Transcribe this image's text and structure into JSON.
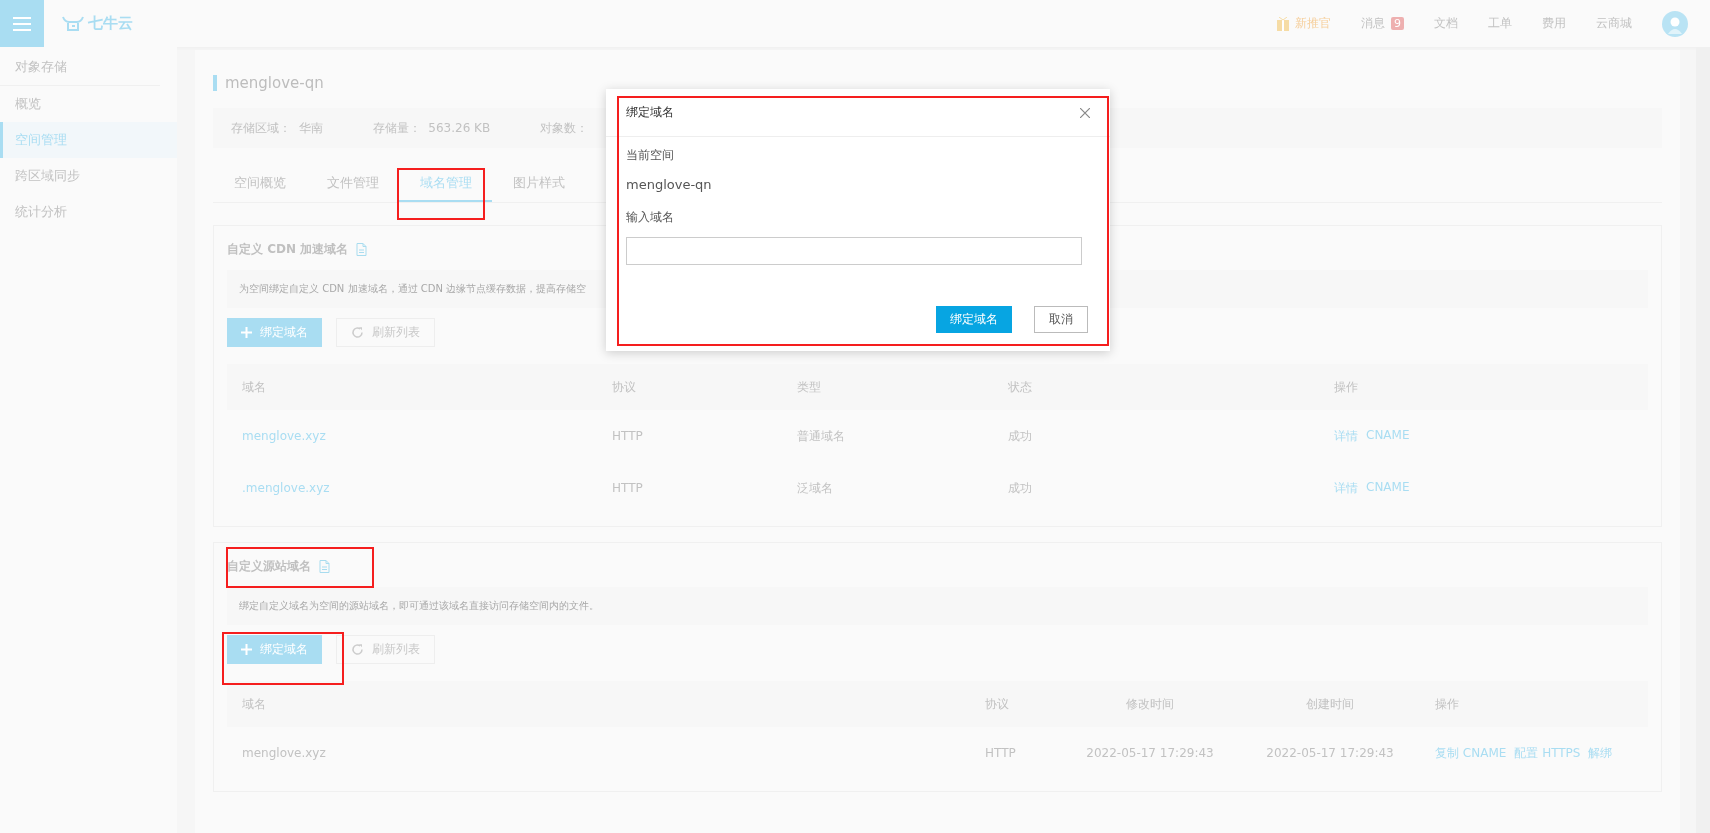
{
  "header": {
    "logo": "七牛云",
    "nav": [
      {
        "label": "新推官",
        "kind": "promo"
      },
      {
        "label": "消息",
        "kind": "badge",
        "badge": "9"
      },
      {
        "label": "文档",
        "kind": "plain"
      },
      {
        "label": "工单",
        "kind": "plain"
      },
      {
        "label": "费用",
        "kind": "plain"
      },
      {
        "label": "云商城",
        "kind": "plain"
      }
    ]
  },
  "sidebar": {
    "heading": "对象存储",
    "items": [
      {
        "label": "概览",
        "selected": false
      },
      {
        "label": "空间管理",
        "selected": true
      },
      {
        "label": "跨区域同步",
        "selected": false
      },
      {
        "label": "统计分析",
        "selected": false
      }
    ]
  },
  "bucket": {
    "title": "menglove-qn",
    "stats": [
      {
        "label": "存储区域：",
        "value": "华南"
      },
      {
        "label": "存储量：",
        "value": "563.26 KB"
      },
      {
        "label": "对象数："
      }
    ]
  },
  "tabs": [
    {
      "label": "空间概览",
      "selected": false
    },
    {
      "label": "文件管理",
      "selected": false
    },
    {
      "label": "域名管理",
      "selected": true
    },
    {
      "label": "图片样式",
      "selected": false
    }
  ],
  "cdn_section": {
    "title": "自定义 CDN 加速域名",
    "description": "为空间绑定自定义 CDN 加速域名，通过 CDN 边缘节点缓存数据，提高存储空",
    "bind_button": "绑定域名",
    "refresh_button": "刷新列表",
    "columns": [
      "域名",
      "协议",
      "类型",
      "状态",
      "操作"
    ],
    "rows": [
      {
        "domain": "menglove.xyz",
        "protocol": "HTTP",
        "type": "普通域名",
        "status": "成功",
        "actions": [
          "详情",
          "CNAME"
        ]
      },
      {
        "domain": ".menglove.xyz",
        "protocol": "HTTP",
        "type": "泛域名",
        "status": "成功",
        "actions": [
          "详情",
          "CNAME"
        ]
      }
    ]
  },
  "source_section": {
    "title": "自定义源站域名",
    "description": "绑定自定义域名为空间的源站域名，即可通过该域名直接访问存储空间内的文件。",
    "bind_button": "绑定域名",
    "refresh_button": "刷新列表",
    "columns": [
      "域名",
      "协议",
      "修改时间",
      "创建时间",
      "操作"
    ],
    "rows": [
      {
        "domain": "menglove.xyz",
        "protocol": "HTTP",
        "modified": "2022-05-17 17:29:43",
        "created": "2022-05-17 17:29:43",
        "actions": [
          "复制 CNAME",
          "配置 HTTPS",
          "解绑"
        ]
      }
    ]
  },
  "dialog": {
    "title": "绑定域名",
    "current_space_label": "当前空间",
    "current_space": "menglove-qn",
    "input_label": "输入域名",
    "confirm_button": "绑定域名",
    "cancel_button": "取消"
  }
}
